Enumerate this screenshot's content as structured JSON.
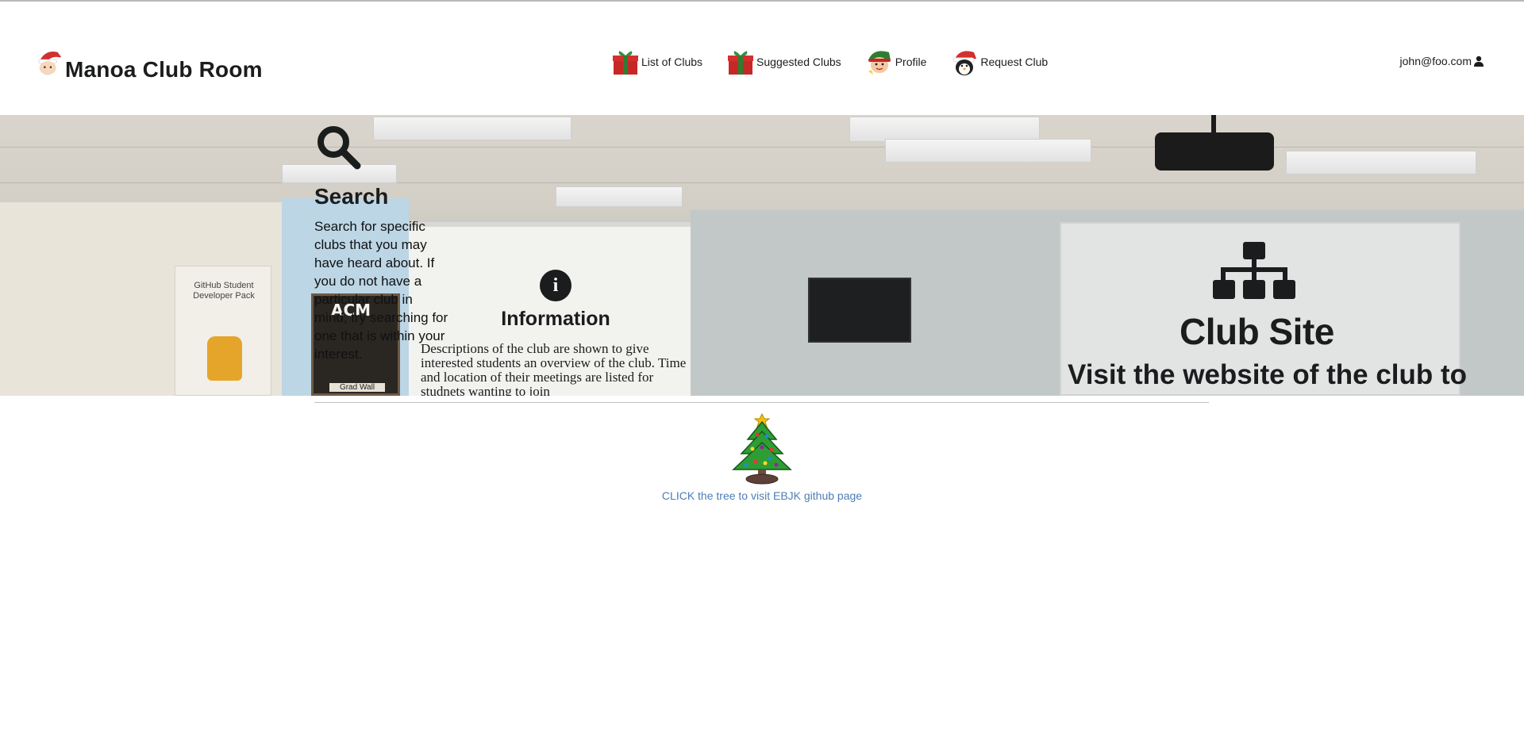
{
  "brand": {
    "name": "Manoa Club Room",
    "logo_icon": "santa-icon"
  },
  "nav": {
    "items": [
      {
        "label": "List of Clubs",
        "icon": "gift-icon"
      },
      {
        "label": "Suggested Clubs",
        "icon": "gift-icon"
      },
      {
        "label": "Profile",
        "icon": "elf-icon"
      },
      {
        "label": "Request Club",
        "icon": "penguin-santa-icon"
      }
    ],
    "user": {
      "email": "john@foo.com",
      "icon": "user-icon"
    }
  },
  "hero": {
    "features": {
      "search": {
        "icon": "search-icon",
        "title": "Search",
        "description": "Search for specific clubs that you may have heard about. If you do not have a particular club in mind, try searching for one that is within your interest."
      },
      "information": {
        "icon": "info-icon",
        "title": "Information",
        "description": "Descriptions of the club are shown to give interested students an overview of the club. Time and location of their meetings are listed for studnets wanting to join"
      },
      "club_site": {
        "icon": "sitemap-icon",
        "title": "Club Site",
        "description": "Visit the website of the club to"
      }
    },
    "background_labels": {
      "poster": "GitHub Student Developer Pack",
      "board": "ACM",
      "grad_wall": "Grad Wall"
    }
  },
  "footer": {
    "tree_icon": "christmas-tree-icon",
    "link_text": "CLICK the tree to visit EBJK github page",
    "link_color": "#4d7db6"
  },
  "colors": {
    "text": "#1b1c1d",
    "link": "#4d7db6",
    "divider": "#bfbfbf"
  }
}
